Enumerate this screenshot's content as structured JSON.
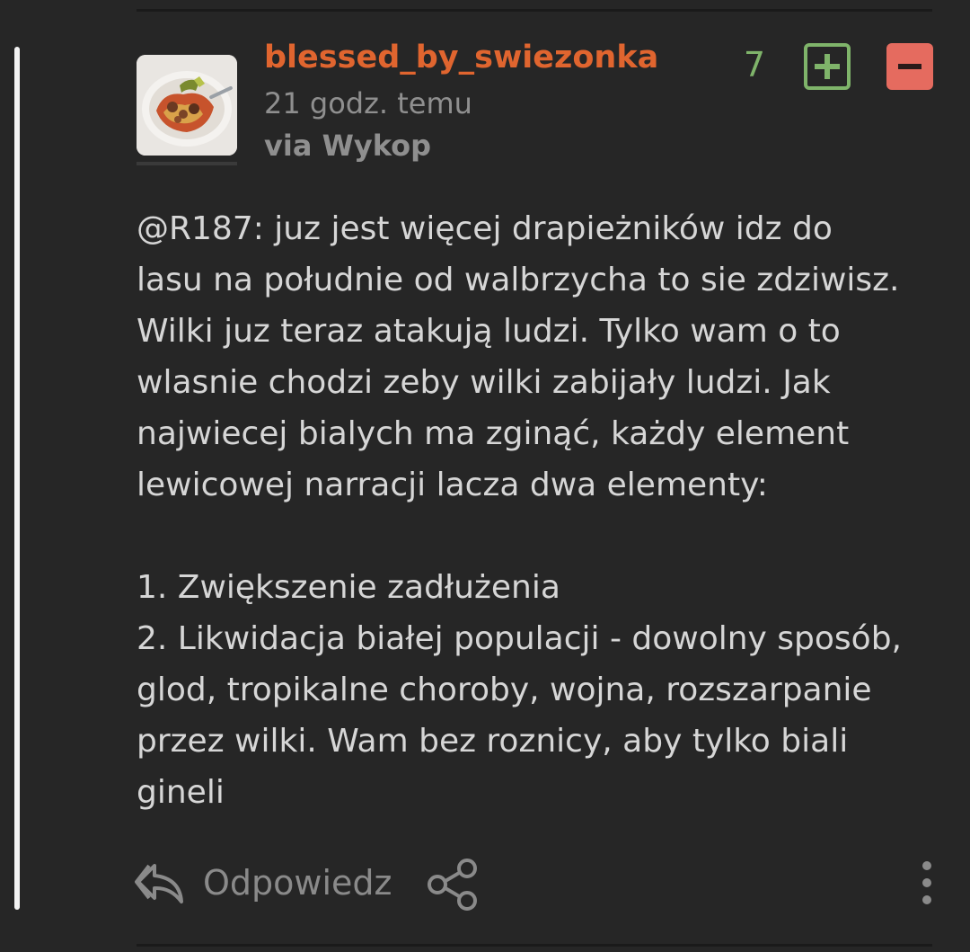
{
  "post": {
    "author": "blessed_by_swiezonka",
    "time": "21 godz. temu",
    "via": "via Wykop",
    "votes": "7",
    "body_lines": [
      "@R187: juz jest więcej drapieżników idz do",
      "lasu na południe od walbrzycha to sie zdziwisz.",
      "Wilki juz teraz atakują ludzi. Tylko wam o to",
      "wlasnie chodzi zeby wilki zabijały ludzi. Jak",
      "najwiecej bialych ma zginąć, każdy element",
      "lewicowej narracji lacza dwa elementy:",
      "1. Zwiększenie zadłużenia",
      "2. Likwidacja białej populacji - dowolny sposób,",
      "glod, tropikalne choroby, wojna, rozszarpanie",
      "przez wilki. Wam bez roznicy, aby tylko biali",
      "gineli"
    ]
  },
  "actions": {
    "reply_label": "Odpowiedz"
  },
  "colors": {
    "background": "#262626",
    "username": "#e0652f",
    "upvote": "#7fb46a",
    "downvote": "#e56b5f",
    "muted": "#8f8f8f",
    "text": "#d6d6d6"
  },
  "icons": {
    "reply": "reply-arrow-icon",
    "share": "share-icon",
    "more": "more-vertical-icon",
    "plus": "plus-icon",
    "minus": "minus-icon"
  }
}
